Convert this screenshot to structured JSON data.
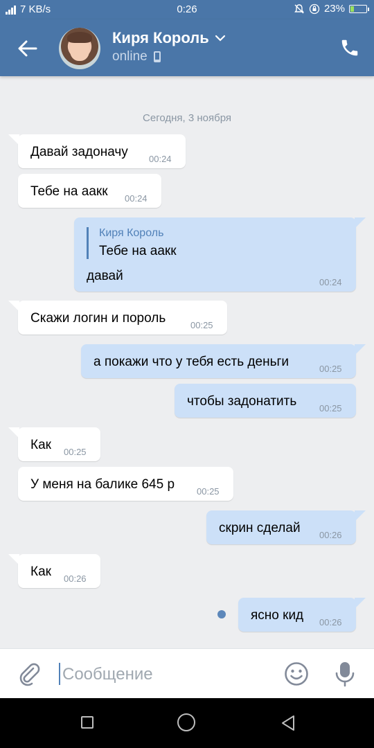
{
  "statusbar": {
    "net_speed": "7 KB/s",
    "time": "0:26",
    "battery": "23%"
  },
  "header": {
    "name": "Киря Король",
    "status": "online"
  },
  "chat": {
    "date": "Сегодня, 3 ноября",
    "messages": [
      {
        "text": "Давай задоначу",
        "time": "00:24"
      },
      {
        "text": "Тебе на аакк",
        "time": "00:24"
      },
      {
        "reply_name": "Киря Король",
        "reply_text": "Тебе на аакк",
        "text": "давай",
        "time": "00:24"
      },
      {
        "text": "Скажи логин и пороль",
        "time": "00:25"
      },
      {
        "text": "а покажи что у тебя есть деньги",
        "time": "00:25"
      },
      {
        "text": "чтобы задонатить",
        "time": "00:25"
      },
      {
        "text": "Как",
        "time": "00:25"
      },
      {
        "text": "У меня на балике 645 р",
        "time": "00:25"
      },
      {
        "text": "скрин сделай",
        "time": "00:26"
      },
      {
        "text": "Как",
        "time": "00:26"
      },
      {
        "text": "ясно кид",
        "time": "00:26"
      }
    ]
  },
  "input": {
    "placeholder": "Сообщение"
  },
  "colors": {
    "header": "#4a76a8",
    "outgoing": "#cce0f8",
    "incoming": "#ffffff",
    "background": "#edeef0"
  },
  "icons": [
    "signal-icon",
    "bell-off-icon",
    "lock-rotation-icon",
    "battery-icon",
    "back-arrow-icon",
    "chevron-down-icon",
    "phone-icon",
    "attach-icon",
    "emoji-icon",
    "mic-icon"
  ]
}
